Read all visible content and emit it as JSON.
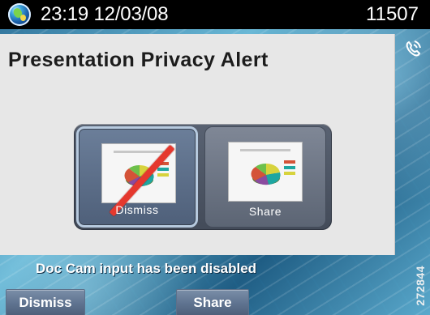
{
  "status_bar": {
    "datetime": "23:19 12/03/08",
    "extension": "11507",
    "status_icon": "globe-icon"
  },
  "dialog": {
    "title": "Presentation Privacy Alert",
    "right_icon": "handset-icon",
    "options": [
      {
        "label": "Dismiss",
        "icon": "presentation-thumbnail",
        "overlay_icon": "red-slash-icon",
        "selected": true
      },
      {
        "label": "Share",
        "icon": "presentation-thumbnail",
        "selected": false
      }
    ]
  },
  "message": "Doc Cam input has been disabled",
  "softkeys": {
    "dismiss": "Dismiss",
    "share": "Share"
  },
  "side_label": "272844",
  "colors": {
    "status_bar": "#000000",
    "dialog_background": "#e7e7e7",
    "selected_tile": "#6b7e99",
    "tile_background": "#7f8796",
    "accent_red": "#e5382e",
    "softkey": "#5f7390"
  }
}
